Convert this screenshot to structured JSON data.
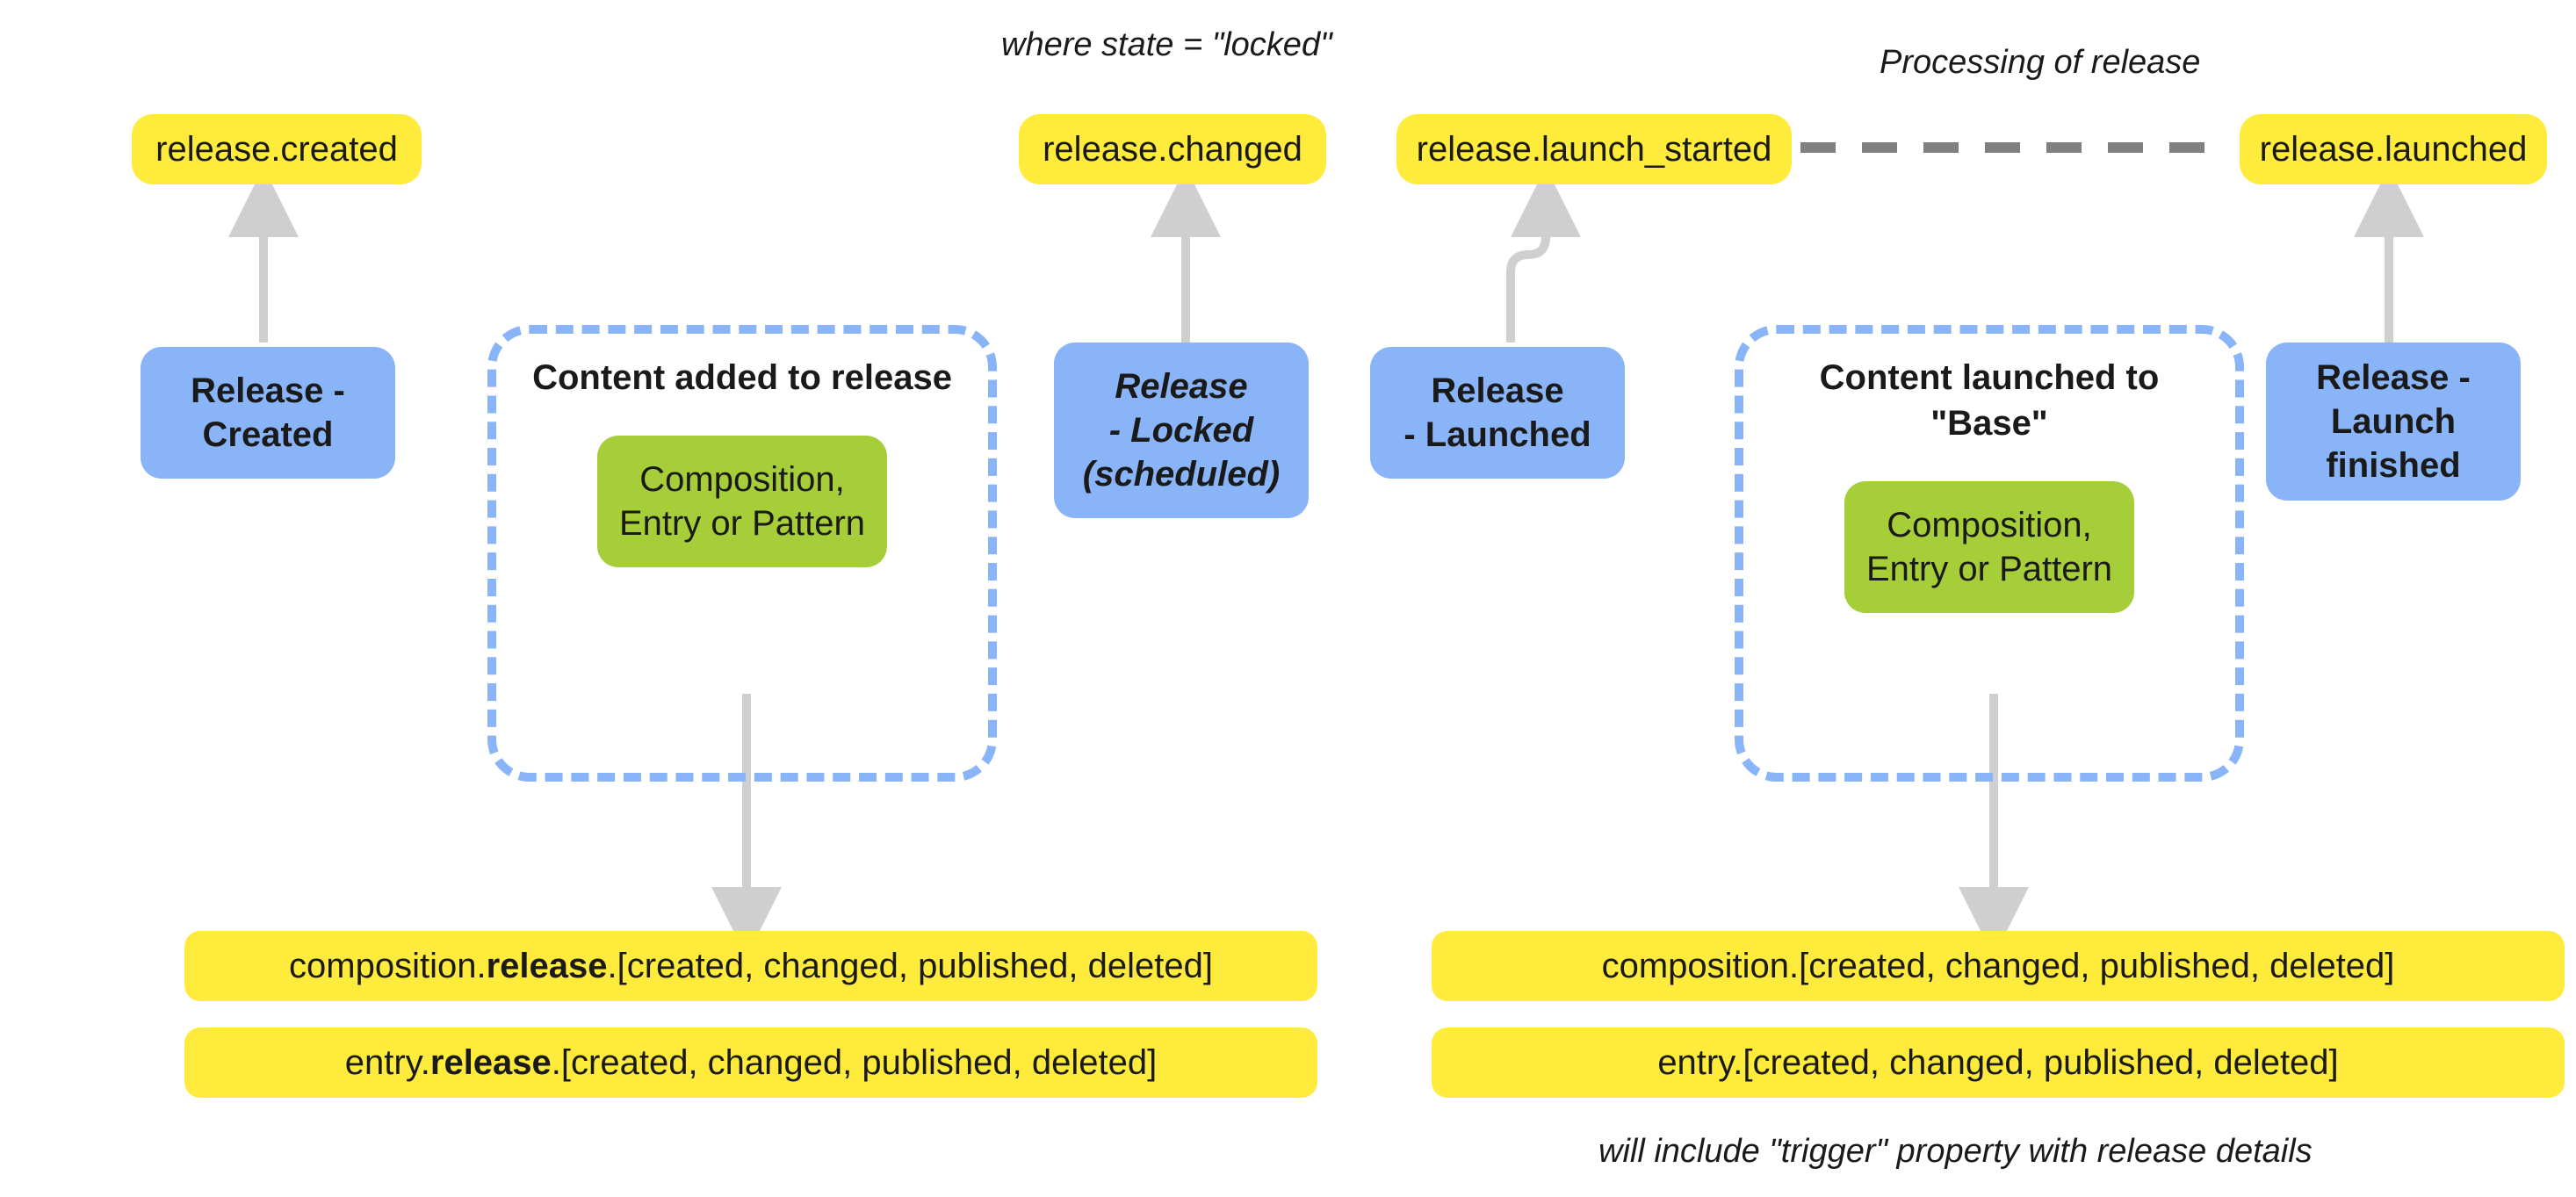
{
  "events": {
    "created": "release.created",
    "changed": "release.changed",
    "launch_started": "release.launch_started",
    "launched": "release.launched"
  },
  "states": {
    "created": "Release - Created",
    "locked": "Release\n- Locked (scheduled)",
    "launched": "Release\n- Launched",
    "launch_finished": "Release - Launch finished"
  },
  "content_groups": {
    "added": {
      "title": "Content added to release",
      "chip": "Composition, Entry or Pattern"
    },
    "launched": {
      "title": "Content launched to \"Base\"",
      "chip": "Composition, Entry or Pattern"
    }
  },
  "bars": {
    "left_comp_prefix": "composition.",
    "left_bold": "release",
    "left_comp_suffix": ".[created, changed, published, deleted]",
    "left_entry_prefix": "entry.",
    "left_entry_suffix": ".[created, changed, published, deleted]",
    "right_comp": "composition.[created, changed, published, deleted]",
    "right_entry": "entry.[created, changed, published, deleted]"
  },
  "annotations": {
    "where_state": "where state = \"locked\"",
    "processing": "Processing of release",
    "trigger": "will include \"trigger\" property with release details"
  }
}
